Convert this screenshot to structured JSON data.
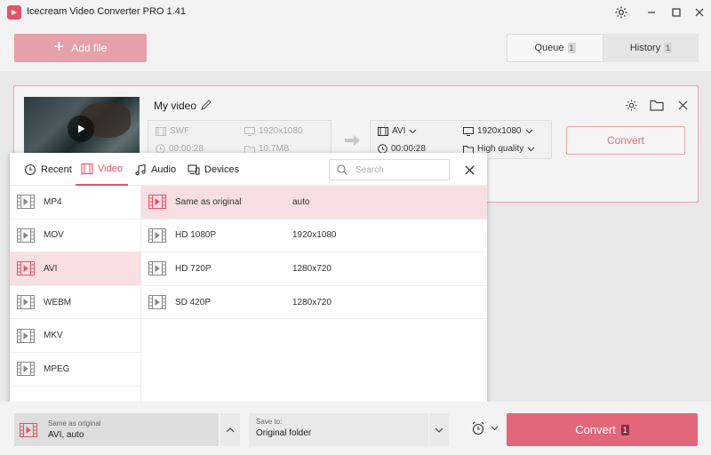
{
  "window": {
    "title": "Icecream Video Converter PRO 1.41",
    "controls": [
      "gear-icon",
      "minimize-icon",
      "maximize-icon",
      "close-icon"
    ]
  },
  "header": {
    "add_file_label": "Add file",
    "tabs": [
      {
        "label": "Queue",
        "count": "1",
        "active": true
      },
      {
        "label": "History",
        "count": "1",
        "active": false
      }
    ]
  },
  "video": {
    "name": "My video",
    "source": {
      "format": "SWF",
      "resolution": "1920x1080",
      "duration": "00:00:28",
      "size": "10.7MB"
    },
    "output": {
      "format": "AVI",
      "resolution": "1920x1080",
      "duration": "00:00:28",
      "quality": "High quality"
    },
    "convert_label": "Convert"
  },
  "popup": {
    "tabs": [
      {
        "label": "Recent",
        "icon": "clock-icon"
      },
      {
        "label": "Video",
        "icon": "film-icon",
        "active": true
      },
      {
        "label": "Audio",
        "icon": "music-icon"
      },
      {
        "label": "Devices",
        "icon": "devices-icon"
      }
    ],
    "search_placeholder": "Search",
    "formats": [
      {
        "label": "MP4"
      },
      {
        "label": "MOV"
      },
      {
        "label": "AVI",
        "active": true
      },
      {
        "label": "WEBM"
      },
      {
        "label": "MKV"
      },
      {
        "label": "MPEG"
      }
    ],
    "presets": [
      {
        "name": "Same as original",
        "resolution": "auto",
        "active": true
      },
      {
        "name": "HD 1080P",
        "resolution": "1920x1080"
      },
      {
        "name": "HD 720P",
        "resolution": "1280x720"
      },
      {
        "name": "SD 420P",
        "resolution": "1280x720"
      }
    ]
  },
  "bottom": {
    "format_label": "Same as original",
    "format_value": "AVI, auto",
    "save_label": "Save to:",
    "save_value": "Original folder",
    "convert_label": "Convert",
    "convert_count": "1"
  },
  "colors": {
    "accent": "#e2546b",
    "accent_light": "#e5a0aa",
    "selected_row": "#f7dfe2"
  }
}
